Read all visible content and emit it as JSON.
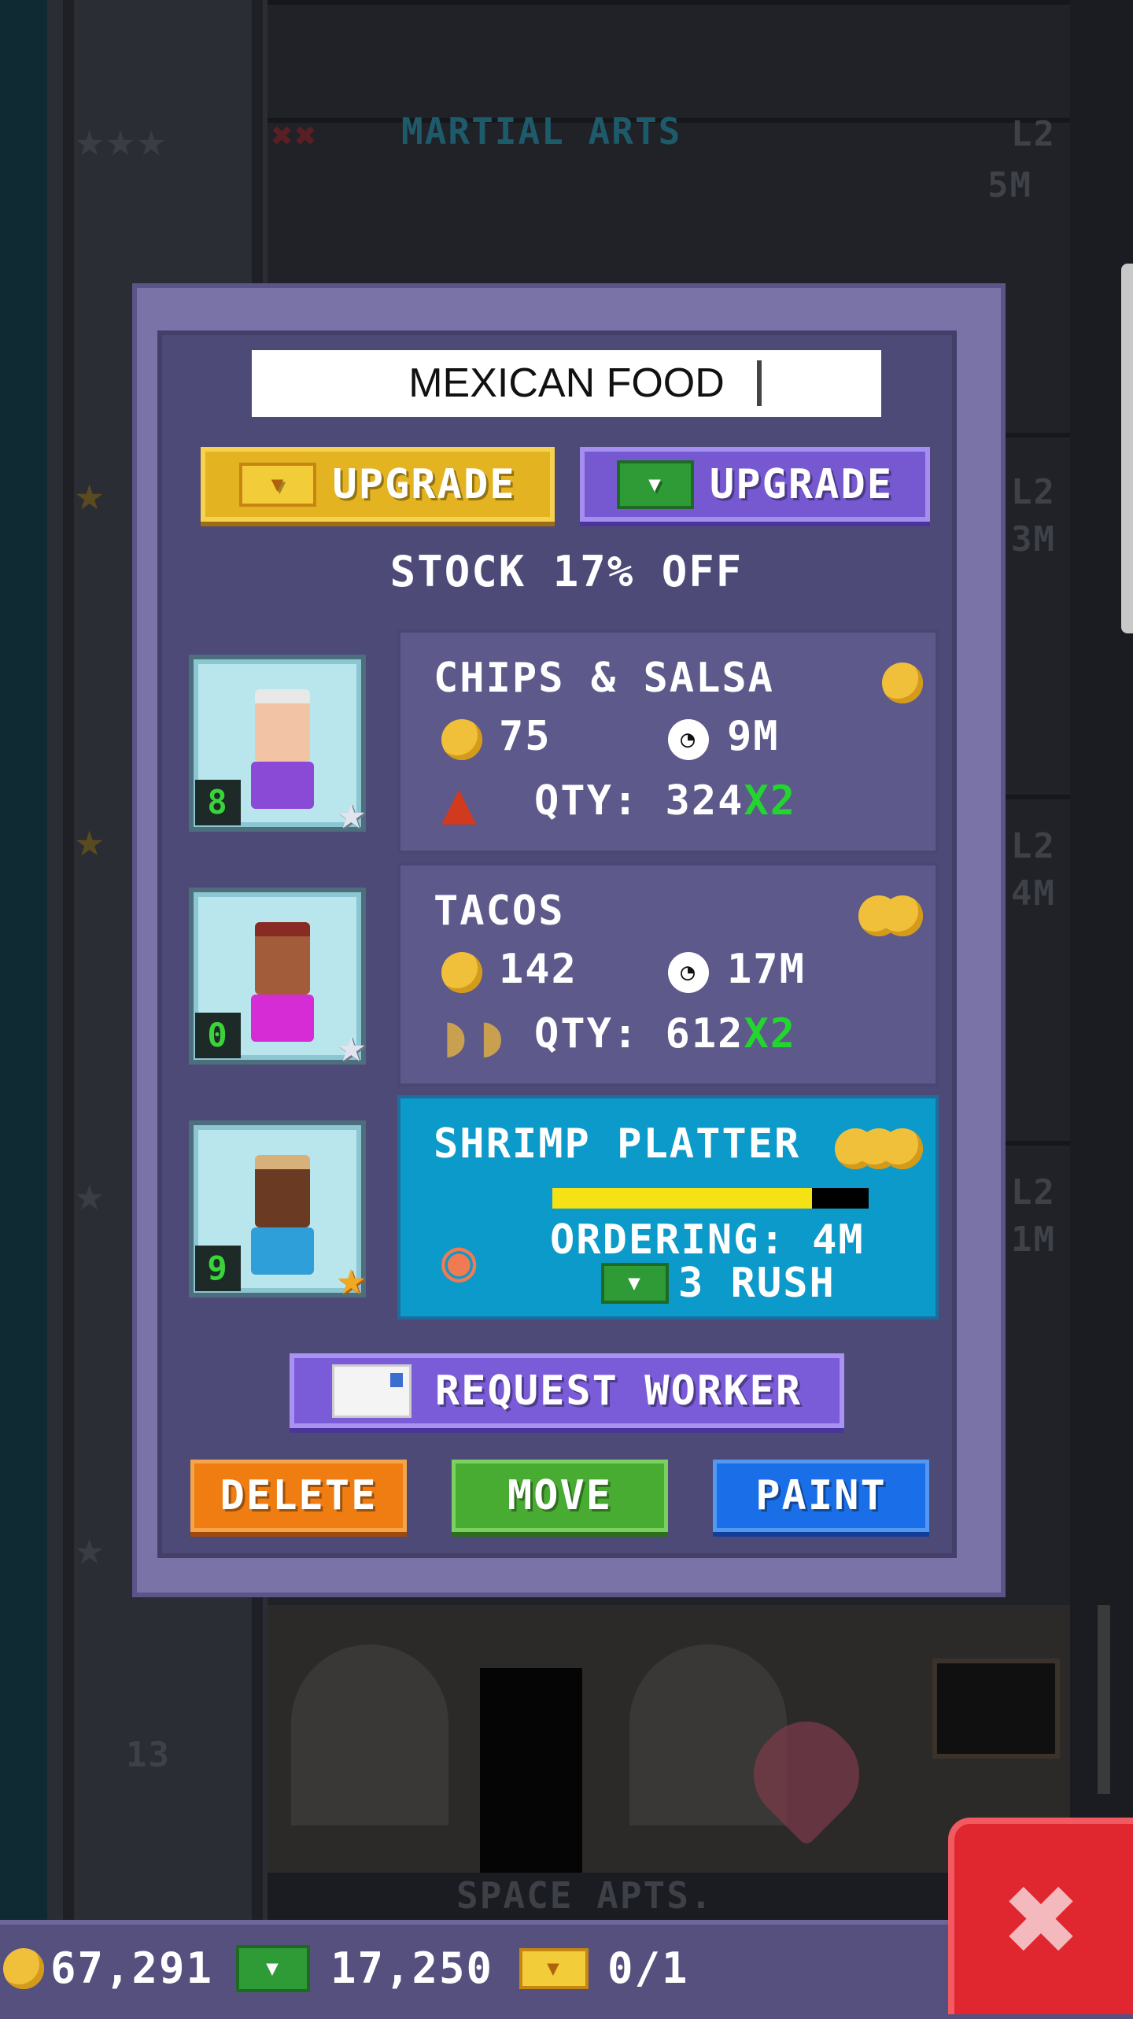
{
  "background": {
    "shop_label": "MARTIAL ARTS",
    "shop_level": "L2",
    "shop_time": "5M",
    "side_levels": [
      "L2",
      "3M",
      "L2",
      "4M",
      "L2",
      "1M"
    ],
    "floor_number": "13",
    "bottom_floor_label": "SPACE APTS."
  },
  "dialog": {
    "name_value": "MEXICAN FOOD",
    "upgrade_gold_label": "UPGRADE",
    "upgrade_cash_label": "UPGRADE",
    "stock_text": "STOCK 17% OFF",
    "request_worker_label": "REQUEST WORKER",
    "delete_label": "DELETE",
    "move_label": "MOVE",
    "paint_label": "PAINT"
  },
  "workers": [
    {
      "level": "8",
      "star": "silver",
      "shirt": "#8a4ad6",
      "hair": "#e8e8e8",
      "skin": "#f2c3a5"
    },
    {
      "level": "0",
      "star": "silver",
      "shirt": "#d62cd6",
      "hair": "#8a2a25",
      "skin": "#a35c3a"
    },
    {
      "level": "9",
      "star": "gold",
      "shirt": "#2e9fd8",
      "hair": "#d7b07a",
      "skin": "#6b3a22"
    }
  ],
  "items": [
    {
      "name": "CHIPS & SALSA",
      "price": "75",
      "time": "9M",
      "qty_label": "QTY:",
      "qty": "324",
      "multiplier": "X2"
    },
    {
      "name": "TACOS",
      "price": "142",
      "time": "17M",
      "qty_label": "QTY:",
      "qty": "612",
      "multiplier": "X2"
    },
    {
      "name": "SHRIMP PLATTER",
      "ordering": "ORDERING: 4M",
      "rush": "3 RUSH",
      "progress": 0.82
    }
  ],
  "currency": {
    "coins": "67,291",
    "bux": "17,250",
    "tickets": "0/1"
  },
  "colors": {
    "panel": "#7a73a8",
    "panel_inner": "#4d4a78",
    "active_row": "#0b9ac9",
    "multiplier_green": "#22d52f",
    "close_red": "#e0262f"
  }
}
